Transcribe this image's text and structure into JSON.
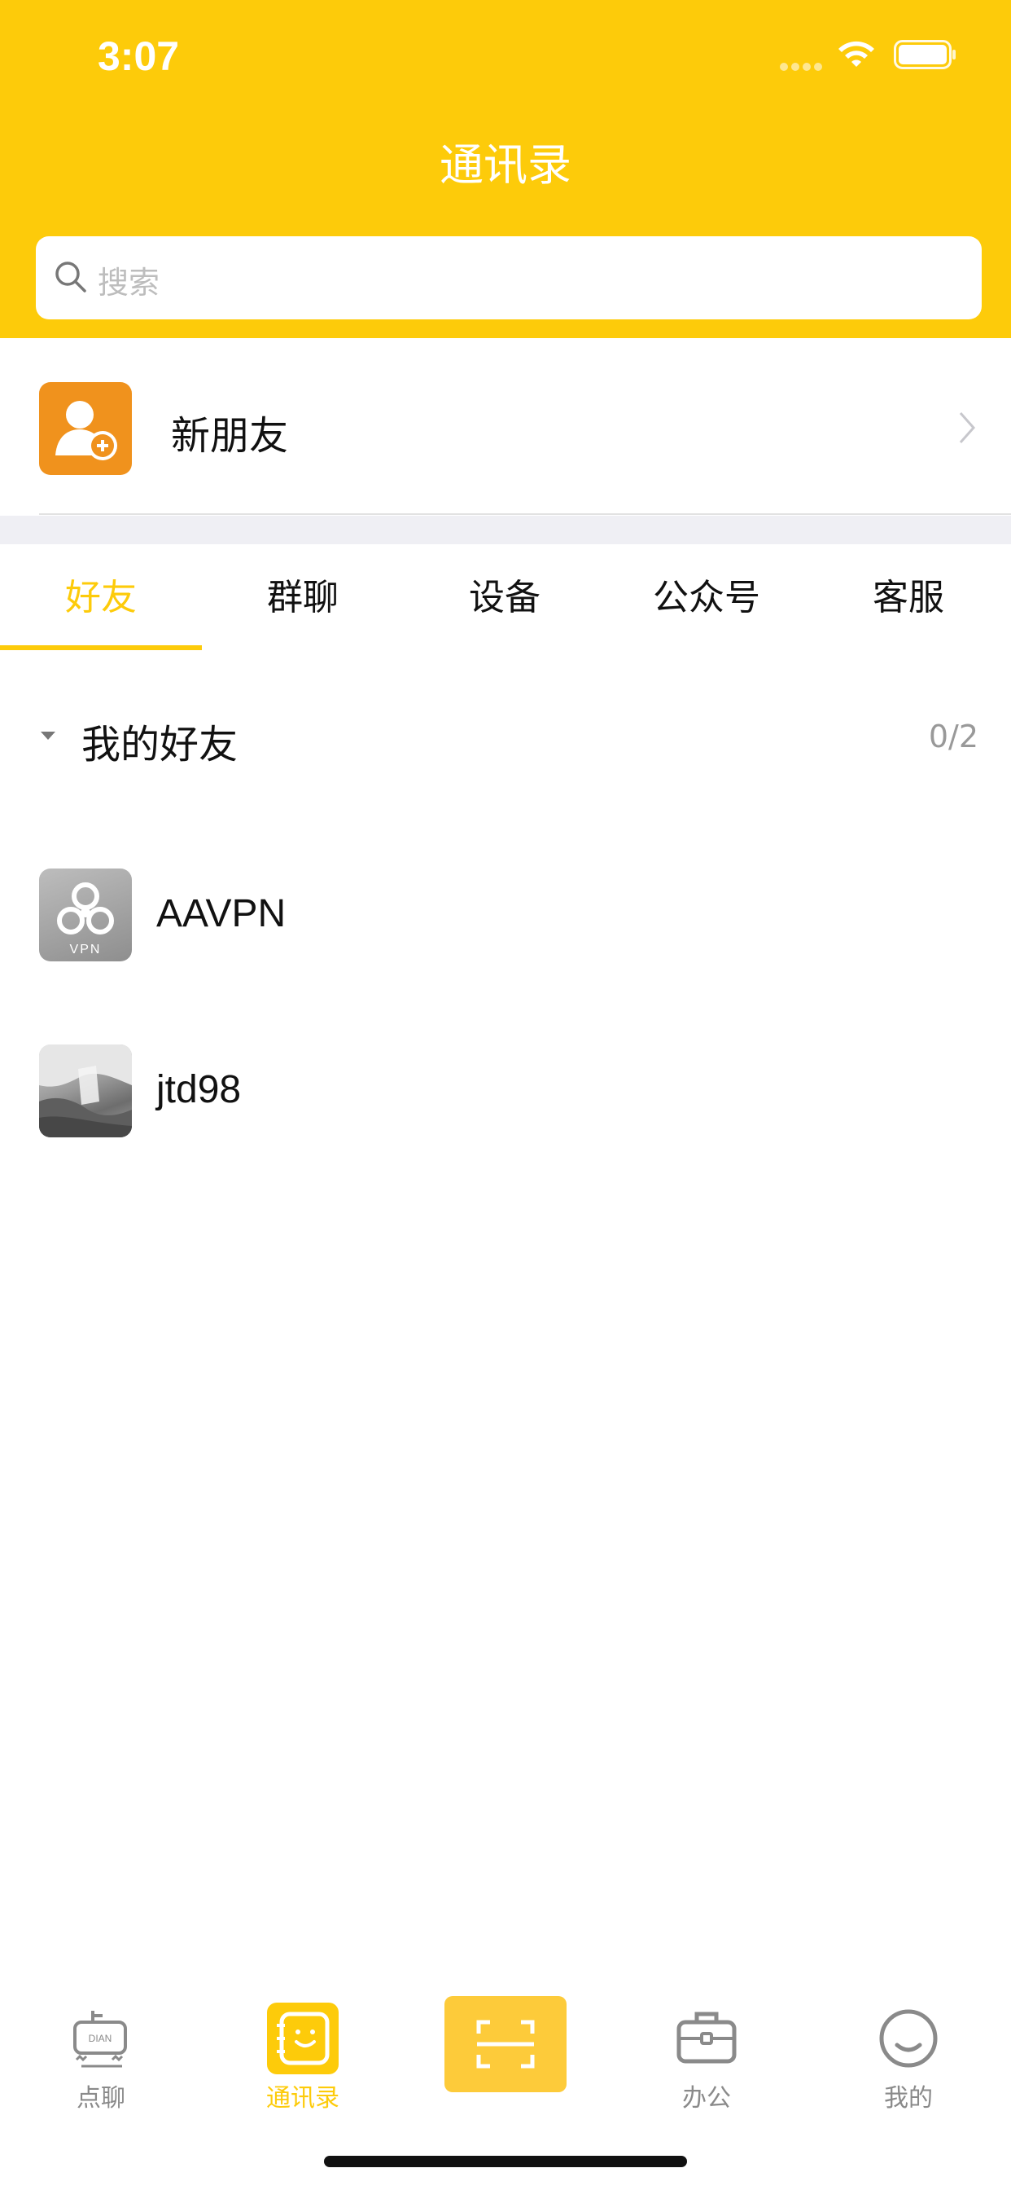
{
  "status_bar": {
    "time": "3:07"
  },
  "header": {
    "title": "通讯录"
  },
  "search": {
    "placeholder": "搜索"
  },
  "new_friend": {
    "label": "新朋友"
  },
  "tabs": [
    {
      "label": "好友",
      "active": true
    },
    {
      "label": "群聊",
      "active": false
    },
    {
      "label": "设备",
      "active": false
    },
    {
      "label": "公众号",
      "active": false
    },
    {
      "label": "客服",
      "active": false
    }
  ],
  "group": {
    "title": "我的好友",
    "count": "0/2"
  },
  "contacts": [
    {
      "name": "AAVPN",
      "avatar_badge": "VPN"
    },
    {
      "name": "jtd98"
    }
  ],
  "tabbar": {
    "items": [
      {
        "label": "点聊",
        "icon": "dian-chat-icon",
        "icon_badge": "DIAN"
      },
      {
        "label": "通讯录",
        "icon": "contacts-book-icon",
        "active": true
      },
      {
        "label": "",
        "icon": "scan-icon"
      },
      {
        "label": "办公",
        "icon": "briefcase-icon"
      },
      {
        "label": "我的",
        "icon": "smiley-icon"
      }
    ]
  },
  "colors": {
    "accent": "#FDCB0A",
    "new_friend_icon": "#F0921D",
    "tab_inactive": "#8a8a8a"
  }
}
